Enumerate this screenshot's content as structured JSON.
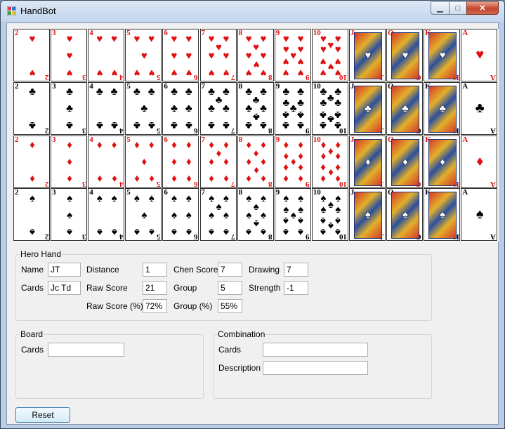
{
  "window": {
    "title": "HandBot",
    "minimize_glyph": "▁",
    "maximize_glyph": "□",
    "close_glyph": "✕",
    "icon": "app-icon"
  },
  "deck": {
    "ranks": [
      "2",
      "3",
      "4",
      "5",
      "6",
      "7",
      "8",
      "9",
      "10",
      "J",
      "Q",
      "K",
      "A"
    ],
    "suits": [
      {
        "name": "hearts",
        "symbol": "♥",
        "color": "#e01010"
      },
      {
        "name": "clubs",
        "symbol": "♣",
        "color": "#000000"
      },
      {
        "name": "diamonds",
        "symbol": "♦",
        "color": "#e01010"
      },
      {
        "name": "spades",
        "symbol": "♠",
        "color": "#000000"
      }
    ]
  },
  "hero": {
    "legend": "Hero Hand",
    "name_label": "Name",
    "name_value": "JT",
    "cards_label": "Cards",
    "cards_value": "Jc Td",
    "distance_label": "Distance",
    "distance_value": "1",
    "raw_score_label": "Raw Score",
    "raw_score_value": "21",
    "raw_score_pct_label": "Raw Score (%)",
    "raw_score_pct_value": "72%",
    "chen_label": "Chen Score",
    "chen_value": "7",
    "group_label": "Group",
    "group_value": "5",
    "group_pct_label": "Group (%)",
    "group_pct_value": "55%",
    "drawing_label": "Drawing",
    "drawing_value": "7",
    "strength_label": "Strength",
    "strength_value": "-1"
  },
  "board": {
    "legend": "Board",
    "cards_label": "Cards",
    "cards_value": ""
  },
  "combination": {
    "legend": "Combination",
    "cards_label": "Cards",
    "cards_value": "",
    "description_label": "Description",
    "description_value": ""
  },
  "reset_label": "Reset"
}
